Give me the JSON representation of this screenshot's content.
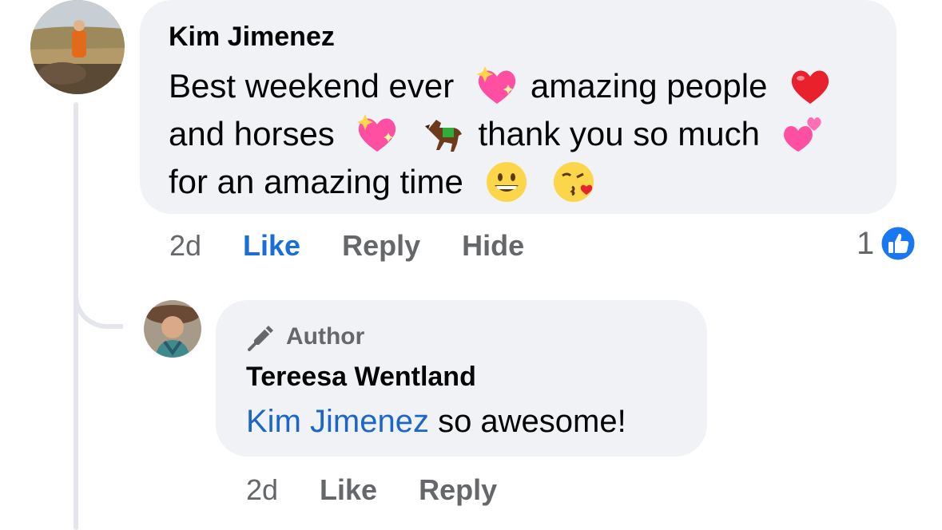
{
  "comment": {
    "author": "Kim Jimenez",
    "text_parts": {
      "p1": "Best weekend ever",
      "p2": "amazing people",
      "p3": "and horses",
      "p4": "thank you so much",
      "p5": "for an amazing time"
    },
    "emojis": [
      "sparkling-heart",
      "red-heart",
      "sparkling-heart",
      "racehorse",
      "two-hearts",
      "grinning-face",
      "face-blowing-kiss"
    ],
    "time": "2d",
    "actions": {
      "like": "Like",
      "reply": "Reply",
      "hide": "Hide"
    },
    "reaction_count": "1"
  },
  "reply": {
    "badge": "Author",
    "author": "Tereesa Wentland",
    "mention": "Kim Jimenez",
    "text": " so awesome!",
    "time": "2d",
    "actions": {
      "like": "Like",
      "reply": "Reply"
    }
  },
  "colors": {
    "bubble": "#f0f2f5",
    "like_blue": "#1a6ed8",
    "mention_blue": "#1b66c9",
    "muted": "#65676b"
  }
}
